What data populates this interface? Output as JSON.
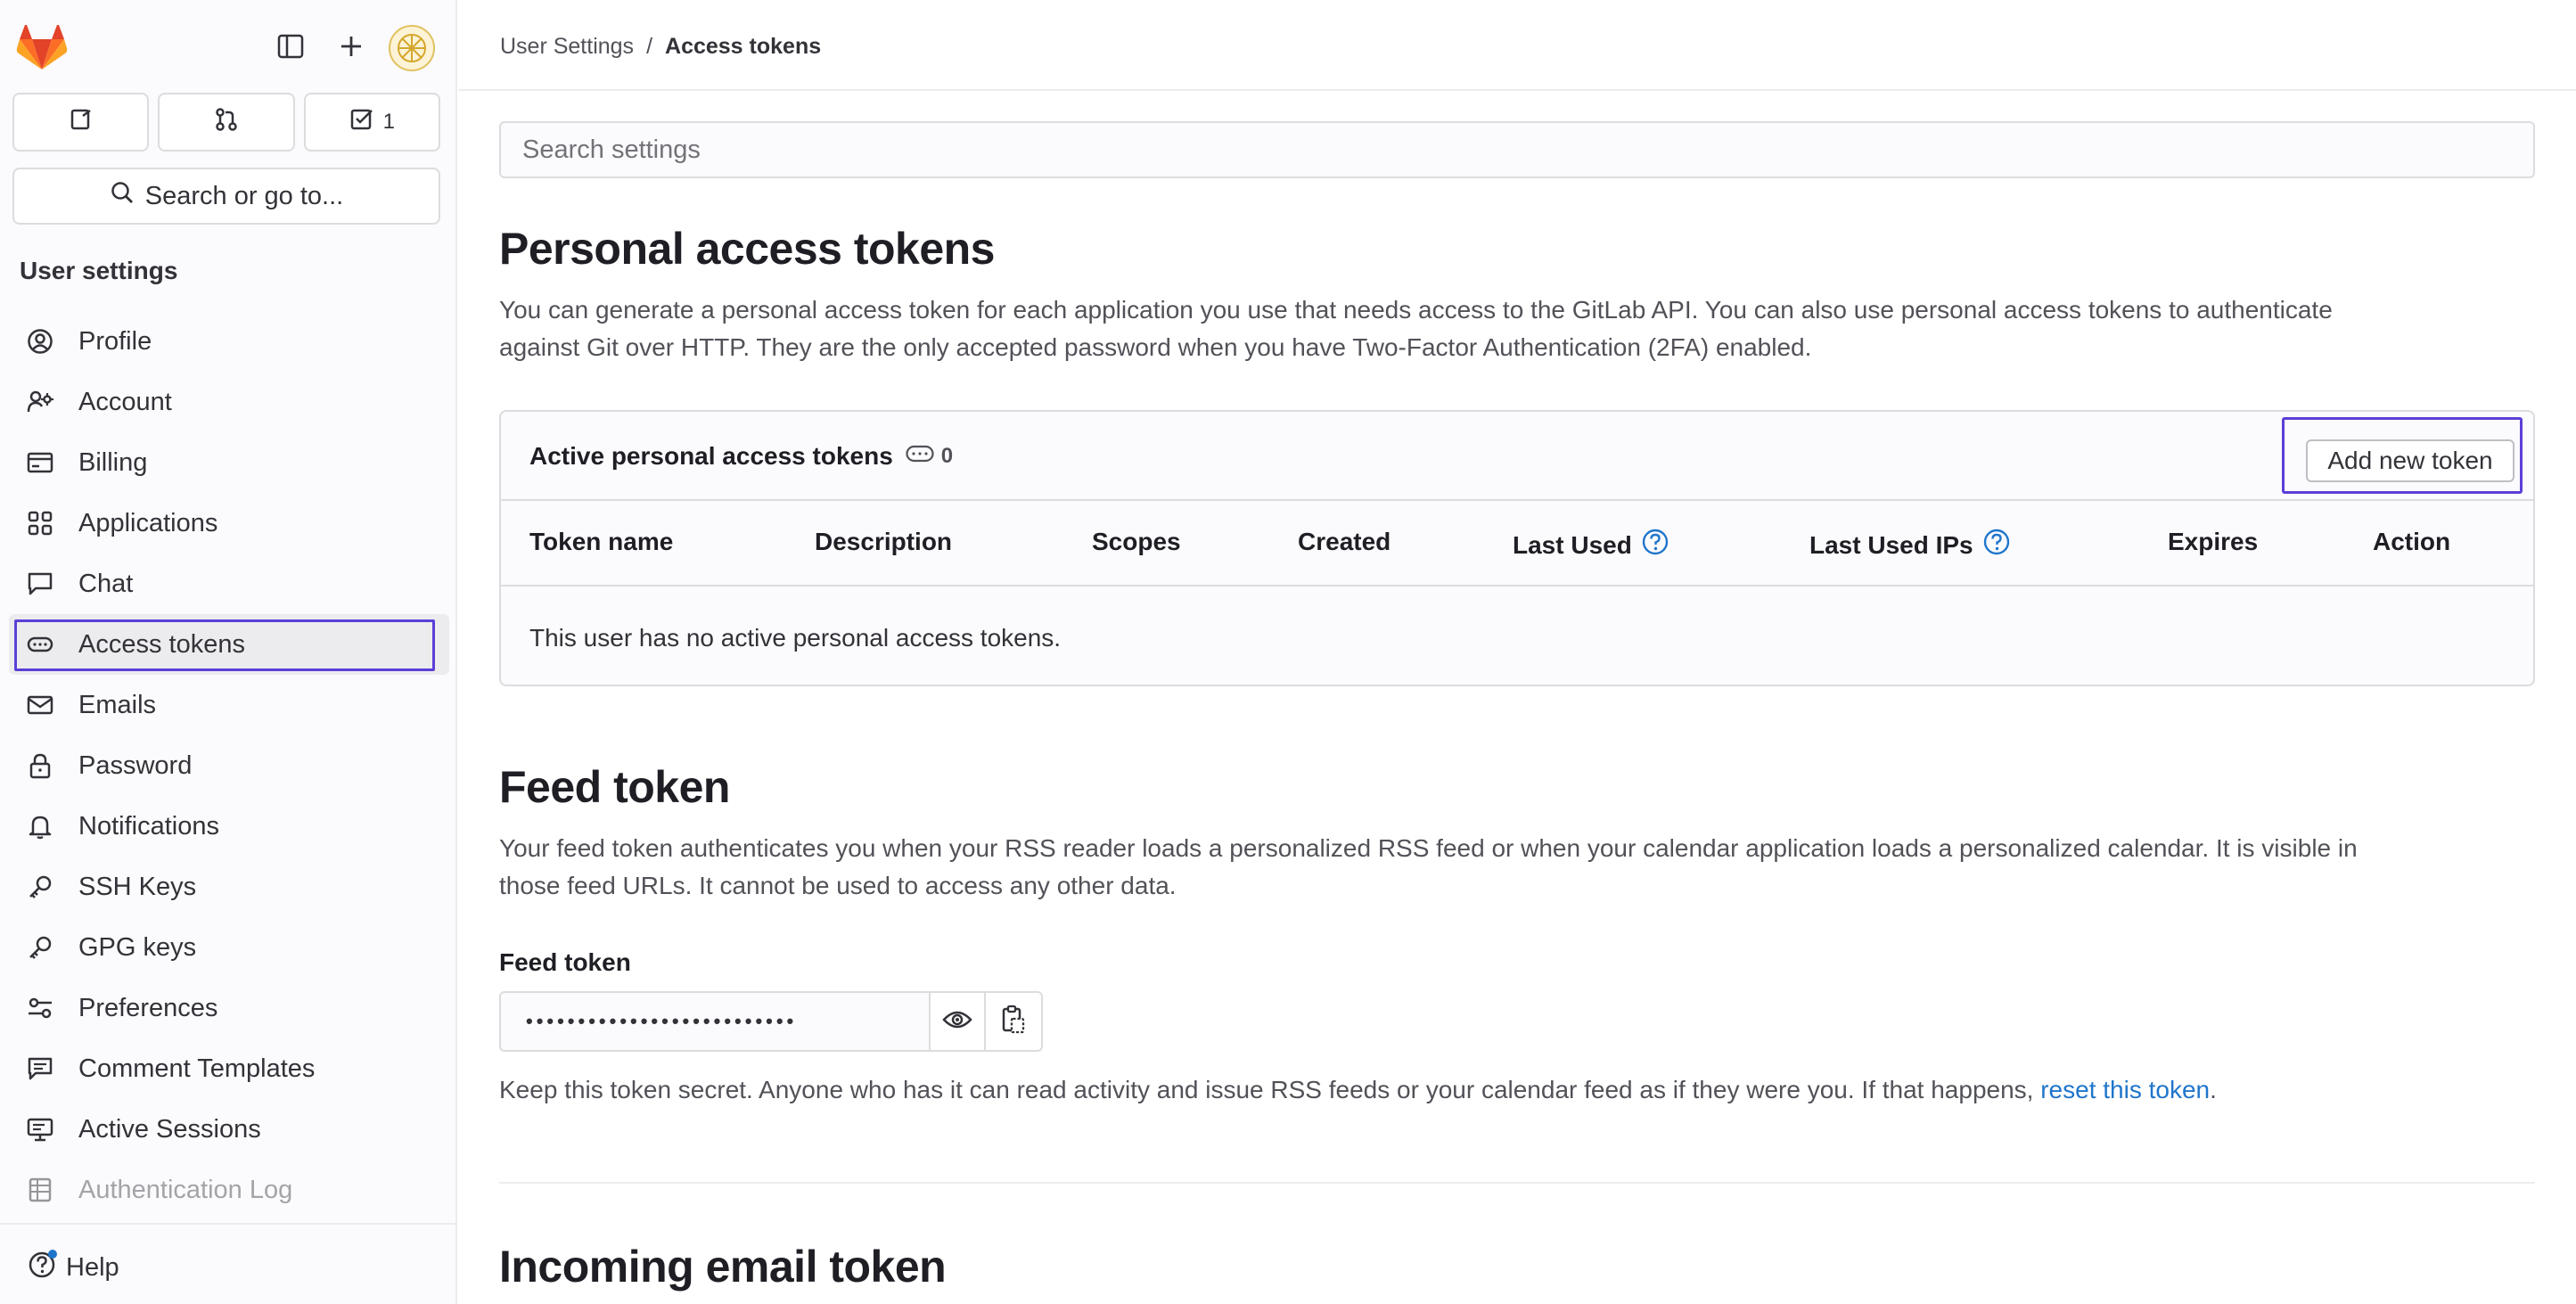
{
  "sidebar": {
    "counters": [
      {
        "icon": "issues-icon",
        "count": ""
      },
      {
        "icon": "merge-request-icon",
        "count": ""
      },
      {
        "icon": "todo-icon",
        "count": "1"
      }
    ],
    "search_label": "Search or go to...",
    "heading": "User settings",
    "items": [
      {
        "label": "Profile",
        "icon": "profile-icon"
      },
      {
        "label": "Account",
        "icon": "account-icon"
      },
      {
        "label": "Billing",
        "icon": "billing-icon"
      },
      {
        "label": "Applications",
        "icon": "applications-icon"
      },
      {
        "label": "Chat",
        "icon": "chat-icon"
      },
      {
        "label": "Access tokens",
        "icon": "token-icon"
      },
      {
        "label": "Emails",
        "icon": "mail-icon"
      },
      {
        "label": "Password",
        "icon": "lock-icon"
      },
      {
        "label": "Notifications",
        "icon": "bell-icon"
      },
      {
        "label": "SSH Keys",
        "icon": "key-icon"
      },
      {
        "label": "GPG keys",
        "icon": "key-icon"
      },
      {
        "label": "Preferences",
        "icon": "preferences-icon"
      },
      {
        "label": "Comment Templates",
        "icon": "comment-icon"
      },
      {
        "label": "Active Sessions",
        "icon": "monitor-icon"
      },
      {
        "label": "Authentication Log",
        "icon": "log-icon"
      }
    ],
    "help_label": "Help"
  },
  "breadcrumb": {
    "parent": "User Settings",
    "separator": "/",
    "current": "Access tokens"
  },
  "search_settings_placeholder": "Search settings",
  "pat": {
    "title": "Personal access tokens",
    "description_line1": "You can generate a personal access token for each application you use that needs access to the GitLab API. You can also use personal access tokens to authenticate",
    "description_line2": "against Git over HTTP. They are the only accepted password when you have Two-Factor Authentication (2FA) enabled.",
    "card_title": "Active personal access tokens",
    "count": "0",
    "add_button": "Add new token",
    "columns": [
      "Token name",
      "Description",
      "Scopes",
      "Created",
      "Last Used",
      "Last Used IPs",
      "Expires",
      "Action"
    ],
    "empty_text": "This user has no active personal access tokens."
  },
  "feed": {
    "title": "Feed token",
    "description_line1": "Your feed token authenticates you when your RSS reader loads a personalized RSS feed or when your calendar application loads a personalized calendar. It is visible in",
    "description_line2": "those feed URLs. It cannot be used to access any other data.",
    "label": "Feed token",
    "masked_value": "••••••••••••••••••••••••••",
    "help_prefix": "Keep this token secret. Anyone who has it can read activity and issue RSS feeds or your calendar feed as if they were you. If that happens, ",
    "help_link": "reset this token",
    "help_suffix": "."
  },
  "incoming": {
    "title": "Incoming email token"
  },
  "colors": {
    "accent": "#5c3fd6",
    "link": "#1f75cb",
    "logo": "#e24329"
  }
}
